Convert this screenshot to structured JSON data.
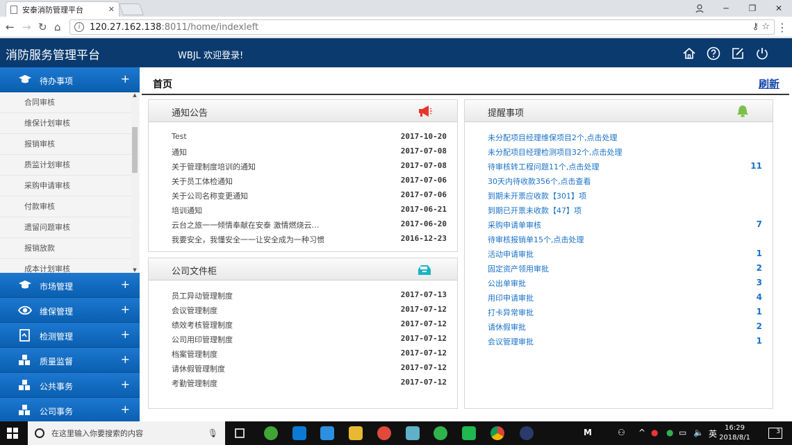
{
  "browser": {
    "tab_title": "安泰消防管理平台",
    "url_host": "120.27.162.138",
    "url_rest": ":8011/home/indexleft"
  },
  "header": {
    "app_name": "消防服务管理平台",
    "welcome": "WBJL 欢迎登录!"
  },
  "sidebar": {
    "groups": [
      {
        "label": "待办事项",
        "icon": "graduation-cap-icon"
      },
      {
        "label": "市场管理",
        "icon": "graduation-cap-icon"
      },
      {
        "label": "维保管理",
        "icon": "eye-icon"
      },
      {
        "label": "检测管理",
        "icon": "document-icon"
      },
      {
        "label": "质量监督",
        "icon": "cubes-icon"
      },
      {
        "label": "公共事务",
        "icon": "cubes-icon"
      },
      {
        "label": "公司事务",
        "icon": "cubes-icon"
      }
    ],
    "sub_items": [
      "合同审核",
      "维保计划审核",
      "报销审核",
      "质监计划审核",
      "采购申请审核",
      "付款审核",
      "遗留问题审核",
      "报销放款",
      "成本计划审核"
    ]
  },
  "page": {
    "title": "首页",
    "refresh": "刷新"
  },
  "notices": {
    "title": "通知公告",
    "items": [
      {
        "text": "Test",
        "date": "2017-10-20"
      },
      {
        "text": "通知",
        "date": "2017-07-08"
      },
      {
        "text": "关于管理制度培训的通知",
        "date": "2017-07-08"
      },
      {
        "text": "关于员工体检通知",
        "date": "2017-07-06"
      },
      {
        "text": "关于公司名称变更通知",
        "date": "2017-07-06"
      },
      {
        "text": "培训通知",
        "date": "2017-06-21"
      },
      {
        "text": "云台之旅一一倾情奉献在安泰 激情燃烧云…",
        "date": "2017-06-20"
      },
      {
        "text": "我要安全，我懂安全一一让安全成为一种习惯",
        "date": "2016-12-23"
      }
    ]
  },
  "files": {
    "title": "公司文件柜",
    "items": [
      {
        "text": "员工异动管理制度",
        "date": "2017-07-13"
      },
      {
        "text": "会议管理制度",
        "date": "2017-07-12"
      },
      {
        "text": "绩效考核管理制度",
        "date": "2017-07-12"
      },
      {
        "text": "公司用印管理制度",
        "date": "2017-07-12"
      },
      {
        "text": "档案管理制度",
        "date": "2017-07-12"
      },
      {
        "text": "请休假管理制度",
        "date": "2017-07-12"
      },
      {
        "text": "考勤管理制度",
        "date": "2017-07-12"
      }
    ]
  },
  "reminders": {
    "title": "提醒事项",
    "items": [
      {
        "text": "未分配项目经理维保项目2个,点击处理",
        "count": ""
      },
      {
        "text": "未分配项目经理检测项目32个,点击处理",
        "count": ""
      },
      {
        "text": "待审核转工程问题11个,点击处理",
        "count": "11"
      },
      {
        "text": "30天内待收款356个,点击查看",
        "count": ""
      },
      {
        "text": "到期未开票应收款【301】项",
        "count": ""
      },
      {
        "text": "到期已开票未收款【47】项",
        "count": ""
      },
      {
        "text": "采购申请单审核",
        "count": "7"
      },
      {
        "text": "待审核报销单15个,点击处理",
        "count": ""
      },
      {
        "text": "活动申请审批",
        "count": "1"
      },
      {
        "text": "固定资产领用审批",
        "count": "2"
      },
      {
        "text": "公出单审批",
        "count": "3"
      },
      {
        "text": "用印申请审批",
        "count": "4"
      },
      {
        "text": "打卡异常审批",
        "count": "1"
      },
      {
        "text": "请休假审批",
        "count": "2"
      },
      {
        "text": "会议管理审批",
        "count": "1"
      }
    ]
  },
  "taskbar": {
    "search_placeholder": "在这里输入你要搜索的内容",
    "ime": "英",
    "time": "16:29",
    "date": "2018/8/1",
    "notif_count": "3",
    "m_label": "M"
  },
  "colors": {
    "header_bg": "#0b3a6e",
    "sidebar_bg": "#0a5fb0",
    "link": "#1a72c9"
  }
}
